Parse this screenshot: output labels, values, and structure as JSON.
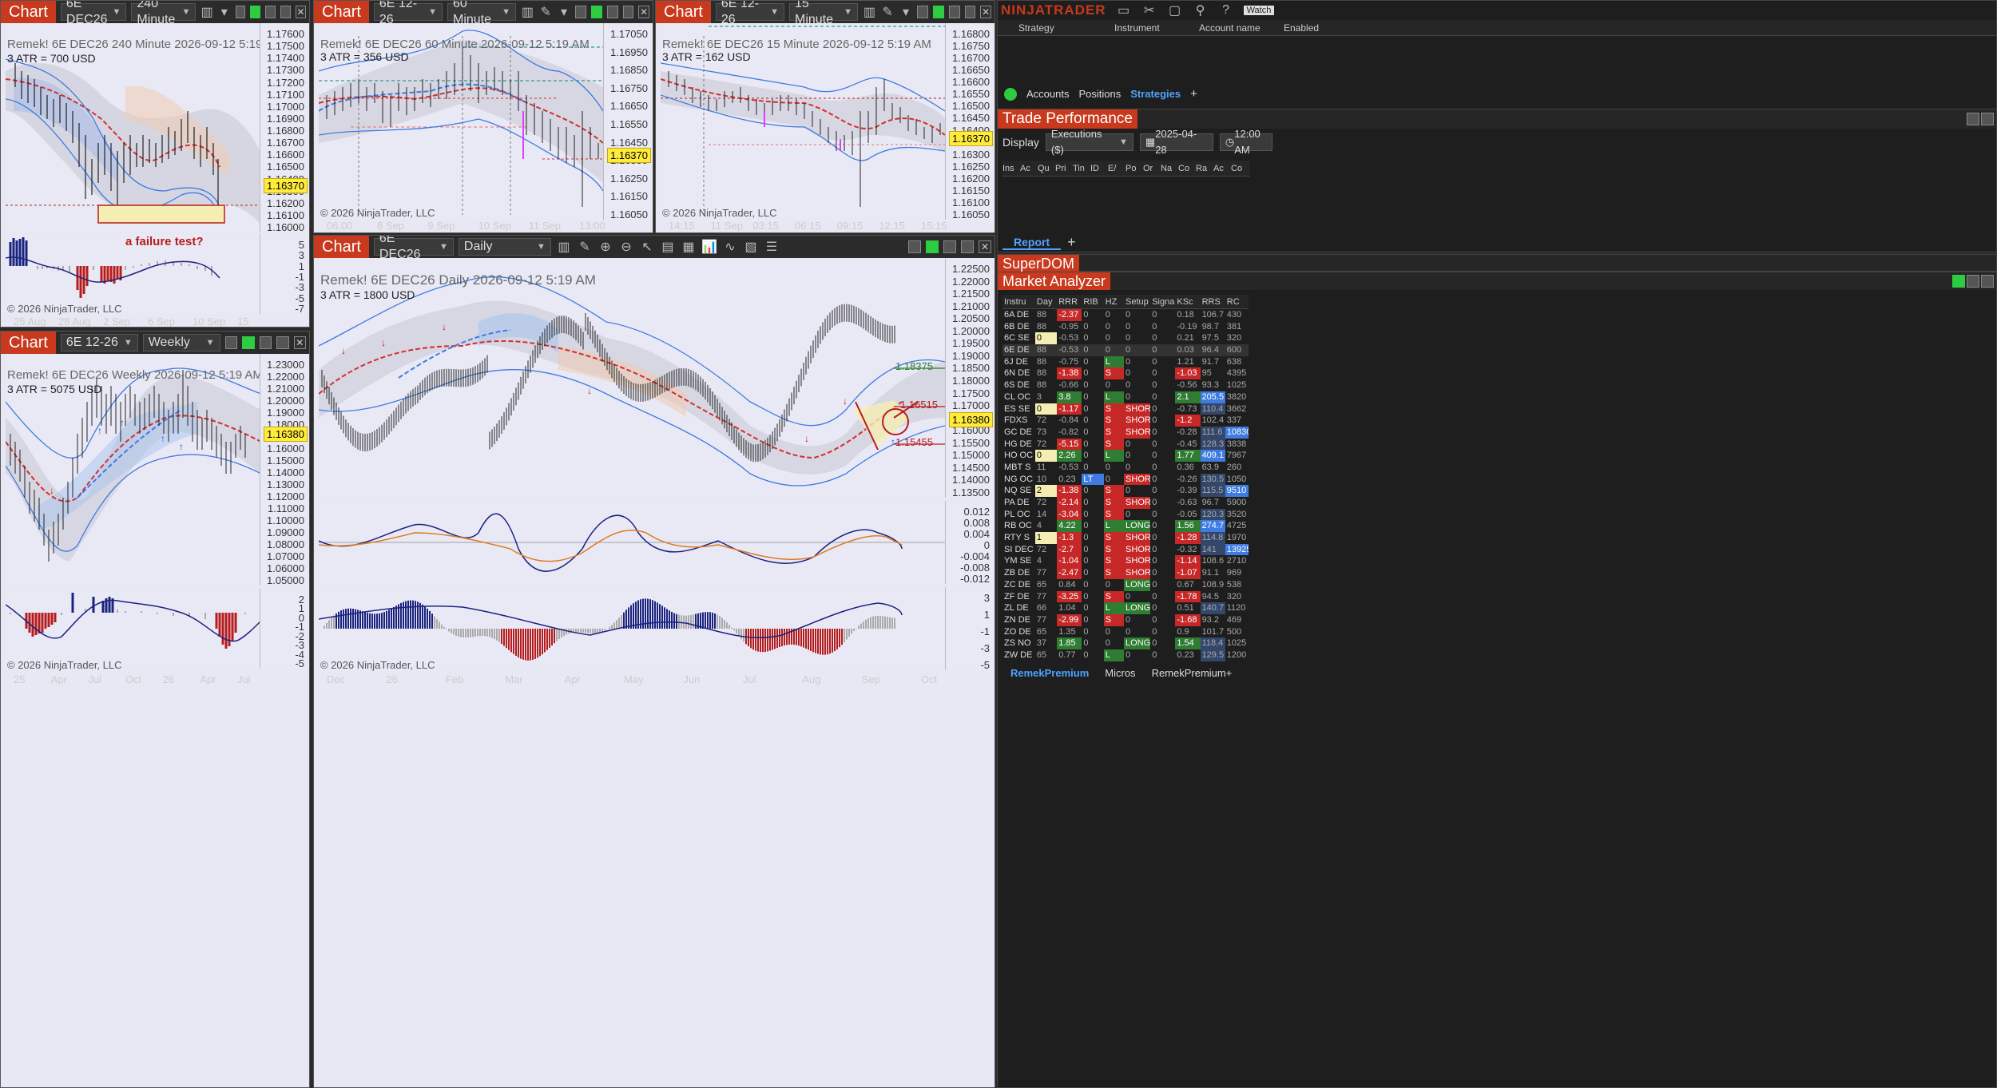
{
  "charts": {
    "c240": {
      "tab": "Chart",
      "instrument": "6E DEC26",
      "period": "240 Minute",
      "title": "Remek!  6E DEC26  240 Minute  2026-09-12 5:19 AM",
      "atr": "3 ATR = 700 USD",
      "price": "1.16370",
      "annotation": "a failure test?",
      "copyright": "© 2026 NinjaTrader, LLC",
      "yticks": [
        "1.17600",
        "1.17500",
        "1.17400",
        "1.17300",
        "1.17200",
        "1.17100",
        "1.17000",
        "1.16900",
        "1.16800",
        "1.16700",
        "1.16600",
        "1.16500",
        "1.16400",
        "1.16300",
        "1.16200",
        "1.16100",
        "1.16000"
      ],
      "osc_ticks": [
        "5",
        "3",
        "1",
        "-1",
        "-3",
        "-5",
        "-7"
      ],
      "xticks": [
        "25 Aug",
        "28 Aug",
        "2 Sep",
        "6 Sep",
        "10 Sep",
        "15 Sep"
      ]
    },
    "c60": {
      "tab": "Chart",
      "instrument": "6E 12-26",
      "period": "60 Minute",
      "title": "Remek!  6E DEC26  60 Minute  2026-09-12 5:19 AM",
      "atr": "3 ATR = 356 USD",
      "price": "1.16370",
      "copyright": "© 2026 NinjaTrader, LLC",
      "yticks": [
        "1.17050",
        "1.16950",
        "1.16850",
        "1.16750",
        "1.16650",
        "1.16550",
        "1.16450",
        "1.16350",
        "1.16250",
        "1.16150",
        "1.16050"
      ],
      "xticks": [
        "06:00",
        "8 Sep",
        "9 Sep",
        "10 Sep",
        "11 Sep",
        "13:00"
      ]
    },
    "c15": {
      "tab": "Chart",
      "instrument": "6E 12-26",
      "period": "15 Minute",
      "title": "Remek!  6E DEC26  15 Minute  2026-09-12 5:19 AM",
      "atr": "3 ATR = 162 USD",
      "price": "1.16370",
      "copyright": "© 2026 NinjaTrader, LLC",
      "yticks": [
        "1.16800",
        "1.16750",
        "1.16700",
        "1.16650",
        "1.16600",
        "1.16550",
        "1.16500",
        "1.16450",
        "1.16400",
        "1.16350",
        "1.16300",
        "1.16250",
        "1.16200",
        "1.16150",
        "1.16100",
        "1.16050"
      ],
      "xticks": [
        "14:15",
        "11 Sep",
        "03:15",
        "06:15",
        "09:15",
        "12:15",
        "15:15"
      ]
    },
    "cw": {
      "tab": "Chart",
      "instrument": "6E 12-26",
      "period": "Weekly",
      "title": "Remek!  6E DEC26  Weekly  2026-09-12 5:19 AM",
      "atr": "3 ATR = 5075 USD",
      "price": "1.16380",
      "copyright": "© 2026 NinjaTrader, LLC",
      "yticks": [
        "1.23000",
        "1.22000",
        "1.21000",
        "1.20000",
        "1.19000",
        "1.18000",
        "1.17000",
        "1.16000",
        "1.15000",
        "1.14000",
        "1.13000",
        "1.12000",
        "1.11000",
        "1.10000",
        "1.09000",
        "1.08000",
        "1.07000",
        "1.06000",
        "1.05000"
      ],
      "osc_ticks": [
        "2",
        "1",
        "0",
        "-1",
        "-2",
        "-3",
        "-4",
        "-5"
      ],
      "xticks": [
        "25",
        "Apr",
        "Jul",
        "Oct",
        "26",
        "Apr",
        "Jul"
      ]
    },
    "cd": {
      "tab": "Chart",
      "instrument": "6E DEC26",
      "period": "Daily",
      "title": "Remek!  6E DEC26  Daily  2026-09-12 5:19 AM",
      "atr": "3 ATR = 1800 USD",
      "price": "1.16380",
      "level_hi": "1.18375",
      "level_mid": "1.16515",
      "level_lo": "1.15455",
      "copyright": "© 2026 NinjaTrader, LLC",
      "yticks": [
        "1.22500",
        "1.22000",
        "1.21500",
        "1.21000",
        "1.20500",
        "1.20000",
        "1.19500",
        "1.19000",
        "1.18500",
        "1.18000",
        "1.17500",
        "1.17000",
        "1.16500",
        "1.16000",
        "1.15500",
        "1.15000",
        "1.14500",
        "1.14000",
        "1.13500"
      ],
      "macd_ticks": [
        "0.012",
        "0.008",
        "0.004",
        "0",
        "-0.004",
        "-0.008",
        "-0.012"
      ],
      "osc_ticks": [
        "3",
        "1",
        "-1",
        "-3",
        "-5"
      ],
      "xticks": [
        "Dec",
        "26",
        "Feb",
        "Mar",
        "Apr",
        "May",
        "Jun",
        "Jul",
        "Aug",
        "Sep",
        "Oct"
      ]
    }
  },
  "control_center": {
    "logo": "NINJATRADER",
    "watch": "Watch",
    "strategy_cols": [
      "Strategy",
      "Instrument",
      "Account name",
      "Enabled"
    ],
    "tabs": [
      "Accounts",
      "Positions",
      "Strategies"
    ]
  },
  "trade_perf": {
    "title": "Trade Performance",
    "display_label": "Display",
    "display_value": "Executions ($)",
    "date": "2025-04-28",
    "time": "12:00 AM",
    "cols": [
      "Ins",
      "Ac",
      "Qu",
      "Pri",
      "Tin",
      "ID",
      "E/",
      "Po",
      "Or",
      "Na",
      "Co",
      "Ra",
      "Ac",
      "Co"
    ],
    "report_tab": "Report"
  },
  "superdom": {
    "title": "SuperDOM"
  },
  "market_analyzer": {
    "title": "Market Analyzer",
    "cols": [
      "Instru",
      "Day",
      "RRR",
      "RIB",
      "HZ",
      "Setup",
      "Signa",
      "KSc",
      "RRS",
      "RC"
    ],
    "rows": [
      [
        "6A DE",
        "88",
        "-2.37",
        "0",
        "0",
        "0",
        "0",
        "0.18",
        "106.7",
        "430"
      ],
      [
        "6B DE",
        "88",
        "-0.95",
        "0",
        "0",
        "0",
        "0",
        "-0.19",
        "98.7",
        "381"
      ],
      [
        "6C SE",
        "0",
        "-0.53",
        "0",
        "0",
        "0",
        "0",
        "0.21",
        "97.5",
        "320"
      ],
      [
        "6E DE",
        "88",
        "-0.53",
        "0",
        "0",
        "0",
        "0",
        "0.03",
        "96.4",
        "600"
      ],
      [
        "6J DE",
        "88",
        "-0.75",
        "0",
        "L",
        "0",
        "0",
        "1.21",
        "91.7",
        "638"
      ],
      [
        "6N DE",
        "88",
        "-1.38",
        "0",
        "S",
        "0",
        "0",
        "-1.03",
        "95",
        "4395"
      ],
      [
        "6S DE",
        "88",
        "-0.66",
        "0",
        "0",
        "0",
        "0",
        "-0.56",
        "93.3",
        "1025"
      ],
      [
        "CL OC",
        "3",
        "3.8",
        "0",
        "L",
        "0",
        "0",
        "2.1",
        "205.5",
        "3820"
      ],
      [
        "ES SE",
        "0",
        "-1.17",
        "0",
        "S",
        "SHOR",
        "0",
        "-0.73",
        "110.4",
        "3662"
      ],
      [
        "FDXS",
        "72",
        "-0.84",
        "0",
        "S",
        "SHOR",
        "0",
        "-1.2",
        "102.4",
        "337"
      ],
      [
        "GC DE",
        "73",
        "-0.82",
        "0",
        "S",
        "SHOR",
        "0",
        "-0.28",
        "111.6",
        "10830"
      ],
      [
        "HG DE",
        "72",
        "-5.15",
        "0",
        "S",
        "0",
        "0",
        "-0.45",
        "128.3",
        "3838"
      ],
      [
        "HO OC",
        "0",
        "2.26",
        "0",
        "L",
        "0",
        "0",
        "1.77",
        "409.1",
        "7967"
      ],
      [
        "MBT S",
        "11",
        "-0.53",
        "0",
        "0",
        "0",
        "0",
        "0.36",
        "63.9",
        "260"
      ],
      [
        "NG OC",
        "10",
        "0.23",
        "LT",
        "0",
        "SHOR",
        "0",
        "-0.26",
        "130.5",
        "1050"
      ],
      [
        "NQ SE",
        "2",
        "-1.38",
        "0",
        "S",
        "0",
        "0",
        "-0.39",
        "115.5",
        "9510"
      ],
      [
        "PA DE",
        "72",
        "-2.14",
        "0",
        "S",
        "SHOR",
        "0",
        "-0.63",
        "96.7",
        "5900"
      ],
      [
        "PL OC",
        "14",
        "-3.04",
        "0",
        "S",
        "0",
        "0",
        "-0.05",
        "120.3",
        "3520"
      ],
      [
        "RB OC",
        "4",
        "4.22",
        "0",
        "L",
        "LONG",
        "0",
        "1.56",
        "274.7",
        "4725"
      ],
      [
        "RTY S",
        "1",
        "-1.3",
        "0",
        "S",
        "SHOR",
        "0",
        "-1.28",
        "114.8",
        "1970"
      ],
      [
        "SI DEC",
        "72",
        "-2.7",
        "0",
        "S",
        "SHOR",
        "0",
        "-0.32",
        "141",
        "13925"
      ],
      [
        "YM SE",
        "4",
        "-1.04",
        "0",
        "S",
        "SHOR",
        "0",
        "-1.14",
        "108.6",
        "2710"
      ],
      [
        "ZB DE",
        "77",
        "-2.47",
        "0",
        "S",
        "SHOR",
        "0",
        "-1.07",
        "91.1",
        "969"
      ],
      [
        "ZC DE",
        "65",
        "0.84",
        "0",
        "0",
        "LONG",
        "0",
        "0.67",
        "108.9",
        "538"
      ],
      [
        "ZF DE",
        "77",
        "-3.25",
        "0",
        "S",
        "0",
        "0",
        "-1.78",
        "94.5",
        "320"
      ],
      [
        "ZL DE",
        "66",
        "1.04",
        "0",
        "L",
        "LONG",
        "0",
        "0.51",
        "140.7",
        "1120"
      ],
      [
        "ZN DE",
        "77",
        "-2.99",
        "0",
        "S",
        "0",
        "0",
        "-1.68",
        "93.2",
        "469"
      ],
      [
        "ZO DE",
        "65",
        "1.35",
        "0",
        "0",
        "0",
        "0",
        "0.9",
        "101.7",
        "500"
      ],
      [
        "ZS NO",
        "37",
        "1.85",
        "0",
        "0",
        "LONG",
        "0",
        "1.54",
        "118.4",
        "1025"
      ],
      [
        "ZW DE",
        "65",
        "0.77",
        "0",
        "L",
        "0",
        "0",
        "0.23",
        "129.5",
        "1200"
      ]
    ],
    "bottom_tabs": [
      "RemekPremium",
      "Micros",
      "RemekPremium+"
    ]
  }
}
